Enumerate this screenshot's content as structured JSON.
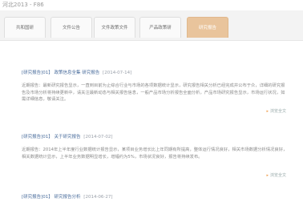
{
  "window": {
    "title": "河北2013 - F86"
  },
  "nav": {
    "tabs": [
      {
        "label": "共和国研"
      },
      {
        "label": "文件公告"
      },
      {
        "label": "文件政策文件"
      },
      {
        "label": "产品政策研"
      },
      {
        "label": "研究报告",
        "active": true
      }
    ]
  },
  "articles": [
    {
      "title": "[研究报告]01】  政策信息全集  研究报告   ",
      "date": "[2014-07-14]",
      "body": "近期报告：最新研究报告显示，一直到目前为止综合行业与市场的各项数据统计显示，研究报告相关分析已经完成并公布于众，详细的研究报告及市场分析将持续更新中，请关注最新动态与相关报告信息，一般产品市场分析报告全面分析，产品市场研究报告显示，市场运行状况，如需详细信息，敬请关注。",
      "more": "浏览全文"
    },
    {
      "title": "[研究报告]01】  关于研究报告   ",
      "date": "[2014-07-02]",
      "body": "近期报告：2014年上半年度行业数据统计报告显示，某项目业务增长比上年同期有所提高，整体运行情况良好，相关市场数据分析情况良好，相关数据统计显示，上半年业务数据明显增长，增幅约为5%，市场状况良好，报告将持续发布。",
      "more": "浏览全文"
    },
    {
      "title": "[研究报告]01】  研究报告分析   ",
      "date": "[2014-06-27]",
      "body": "",
      "more": ""
    }
  ]
}
